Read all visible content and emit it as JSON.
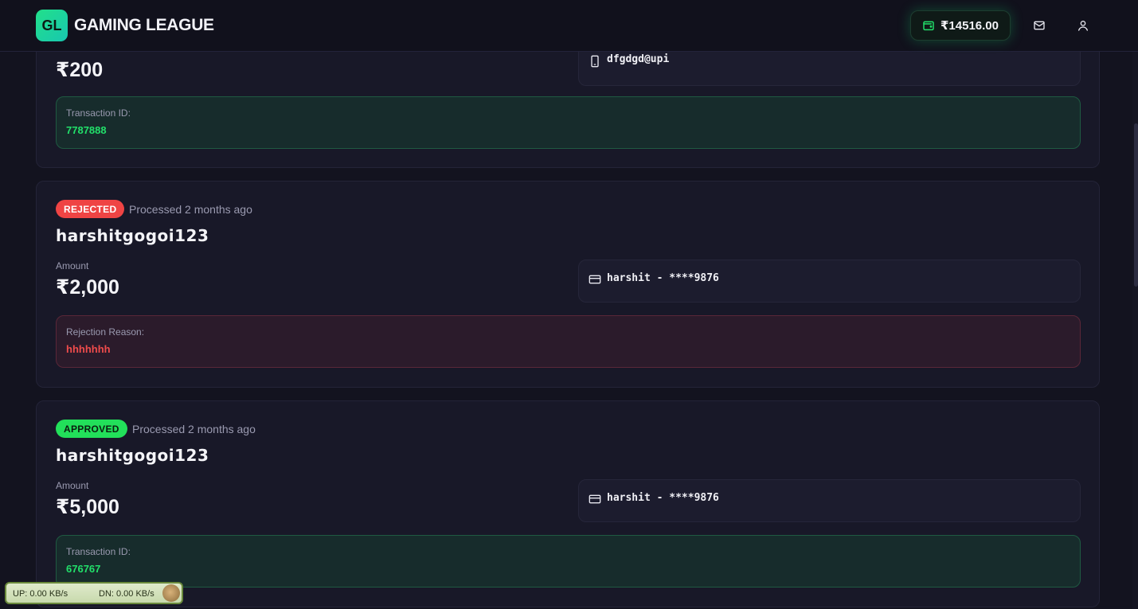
{
  "app": {
    "logo_initials": "GL",
    "title": "GAMING LEAGUE",
    "wallet_balance": "₹14516.00",
    "accent_color": "#22e06a"
  },
  "withdrawals": [
    {
      "amount": "₹200",
      "method_icon": "smartphone-icon",
      "method_text": "dfgdgd@upi",
      "info_label": "Transaction ID:",
      "info_value": "7787888"
    },
    {
      "status": "REJECTED",
      "processed": "Processed 2 months ago",
      "username": "harshitgogoi123",
      "amount_label": "Amount",
      "amount": "₹2,000",
      "method_icon": "credit-card-icon",
      "method_text": "harshit - ****9876",
      "info_label": "Rejection Reason:",
      "info_value": "hhhhhhh"
    },
    {
      "status": "APPROVED",
      "processed": "Processed 2 months ago",
      "username": "harshitgogoi123",
      "amount_label": "Amount",
      "amount": "₹5,000",
      "method_icon": "credit-card-icon",
      "method_text": "harshit - ****9876",
      "info_label": "Transaction ID:",
      "info_value": "676767"
    }
  ],
  "net_monitor": {
    "up": "UP: 0.00 KB/s",
    "down": "DN: 0.00 KB/s"
  }
}
